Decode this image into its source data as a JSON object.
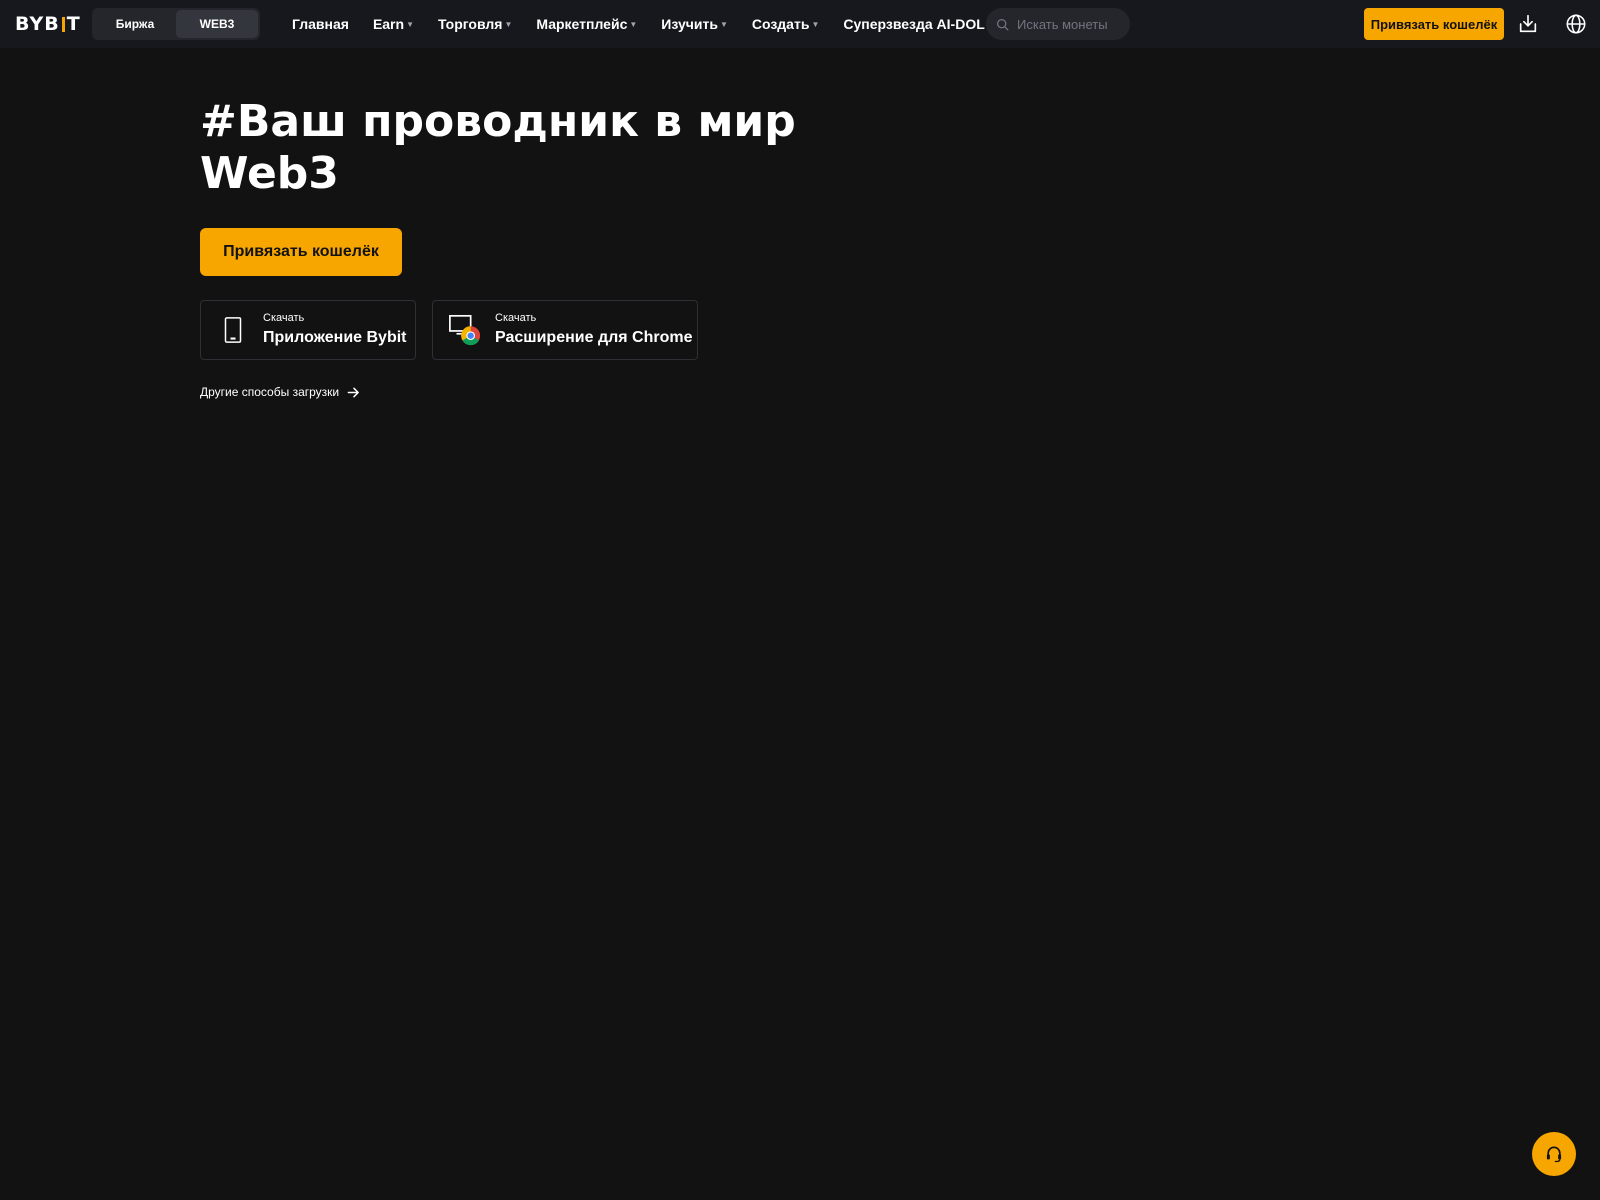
{
  "header": {
    "logo": {
      "part1": "BYB",
      "part2": "T"
    },
    "modes": [
      {
        "label": "Биржа",
        "active": false
      },
      {
        "label": "WEB3",
        "active": true
      }
    ],
    "nav": [
      {
        "label": "Главная",
        "has_dropdown": false
      },
      {
        "label": "Earn",
        "has_dropdown": true
      },
      {
        "label": "Торговля",
        "has_dropdown": true
      },
      {
        "label": "Маркетплейс",
        "has_dropdown": true
      },
      {
        "label": "Изучить",
        "has_dropdown": true
      },
      {
        "label": "Создать",
        "has_dropdown": true
      },
      {
        "label": "Суперзвезда AI-DOL",
        "has_dropdown": false
      }
    ],
    "search": {
      "placeholder": "Искать монеты",
      "icon": "search-icon"
    },
    "connect_label": "Привязать кошелёк",
    "icons": [
      "download-icon",
      "globe-icon"
    ]
  },
  "hero": {
    "title_line1": "#Ваш проводник в мир",
    "title_line2": "Web3",
    "connect_label": "Привязать кошелёк",
    "downloads": [
      {
        "small": "Скачать",
        "big": "Приложение Bybit",
        "icon": "phone-icon"
      },
      {
        "small": "Скачать",
        "big": "Расширение для Chrome",
        "icon": "chrome-extension-icon"
      }
    ],
    "more_link": "Другие способы загрузки"
  },
  "support": {
    "icon": "headset-icon"
  },
  "colors": {
    "accent": "#f7a600",
    "background": "#121212",
    "topbar": "#17181e"
  }
}
